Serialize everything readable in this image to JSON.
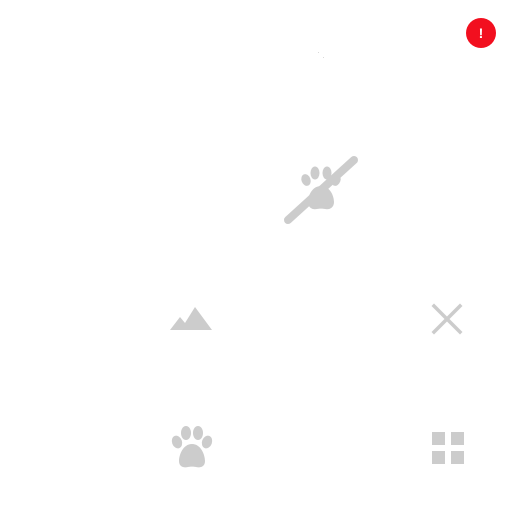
{
  "alert": {
    "glyph": "!",
    "color": "#f20f1f"
  },
  "icons": [
    {
      "name": "paw-off-icon",
      "color": "#cccccc"
    },
    {
      "name": "landscape-icon",
      "color": "#cccccc"
    },
    {
      "name": "close-icon",
      "color": "#cccccc"
    },
    {
      "name": "paw-icon",
      "color": "#cccccc"
    },
    {
      "name": "grid-icon",
      "color": "#cccccc"
    }
  ]
}
